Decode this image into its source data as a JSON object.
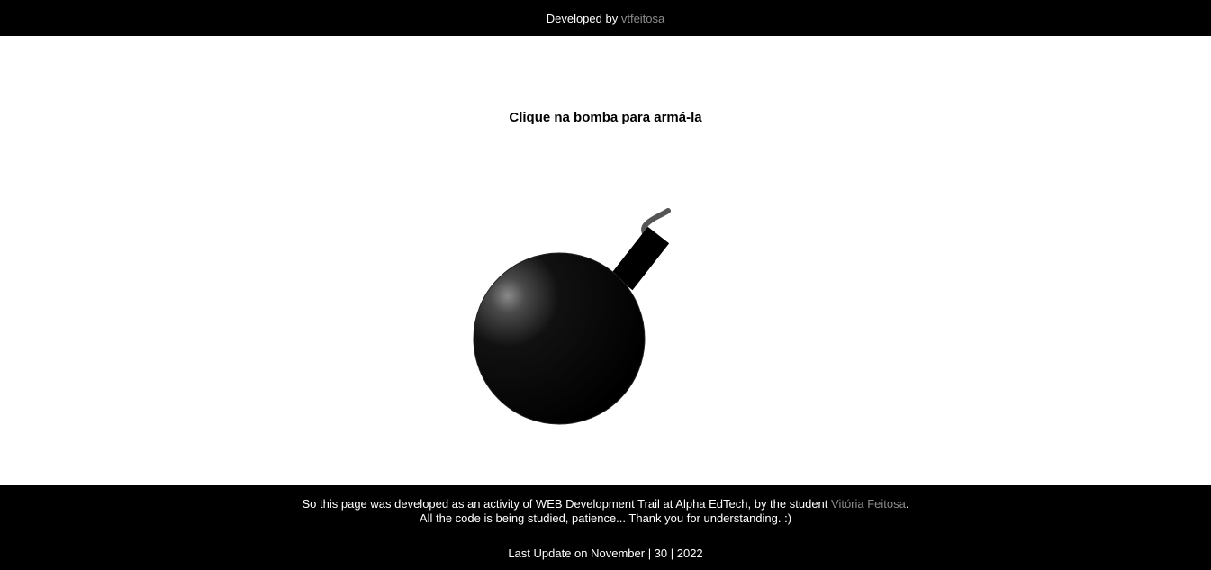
{
  "header": {
    "prefix": "Developed by",
    "author_link": "vtfeitosa"
  },
  "main": {
    "title": "Clique na bomba para armá-la",
    "bomb_icon": "bomb-icon"
  },
  "footer": {
    "line1_text": "So this page was developed as an activity of WEB Development Trail at Alpha EdTech, by the student",
    "line1_link": "Vitória Feitosa",
    "line1_end": ".",
    "line2_text": "All the code is being studied, patience... Thank you for understanding. :)",
    "update_text": "Last Update on November | 30 | 2022"
  },
  "colors": {
    "bar_background": "#000000",
    "link": "#8c8c8c",
    "page_background": "#ffffff"
  }
}
